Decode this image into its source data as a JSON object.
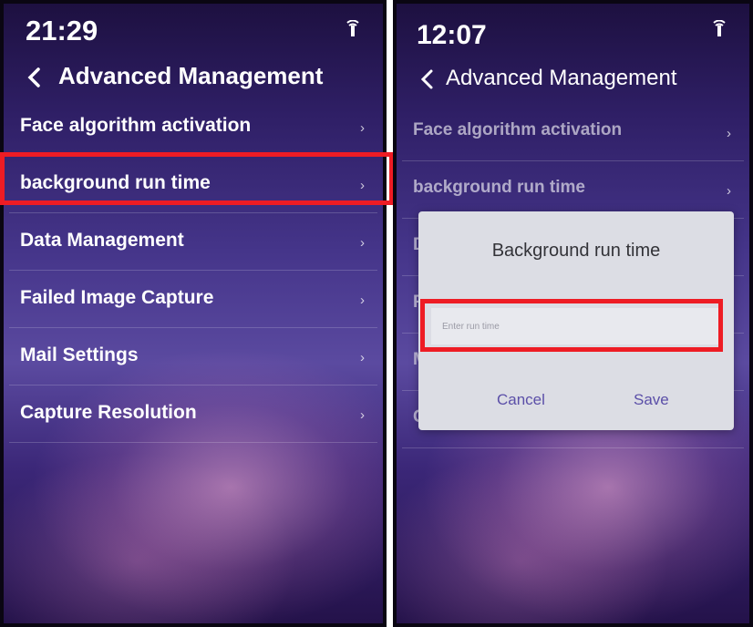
{
  "screens": [
    {
      "status_time": "21:29",
      "title": "Advanced Management",
      "menu": [
        {
          "label": "Face algorithm activation"
        },
        {
          "label": "background run time"
        },
        {
          "label": "Data Management"
        },
        {
          "label": "Failed Image Capture"
        },
        {
          "label": "Mail Settings"
        },
        {
          "label": "Capture Resolution"
        }
      ]
    },
    {
      "status_time": "12:07",
      "title": "Advanced Management",
      "menu": [
        {
          "label": "Face algorithm activation"
        },
        {
          "label": "background run time"
        },
        {
          "label": "D"
        },
        {
          "label": "F"
        },
        {
          "label": "M"
        },
        {
          "label": "C"
        }
      ],
      "dialog": {
        "title": "Background run time",
        "input_value": "",
        "input_placeholder": "Enter run time",
        "cancel_label": "Cancel",
        "save_label": "Save"
      }
    }
  ],
  "chevron_glyph": "›",
  "colors": {
    "highlight": "#ee1c24",
    "accent": "#5b4fa8"
  }
}
